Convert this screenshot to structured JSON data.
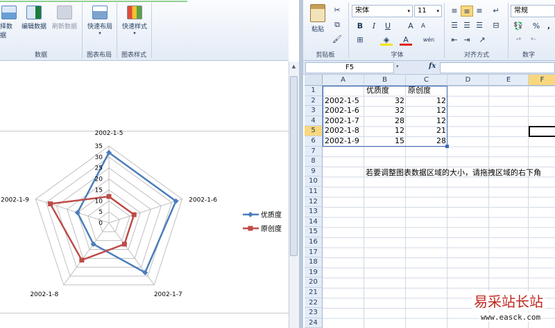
{
  "left_ribbon": {
    "group_data": {
      "label": "数据",
      "buttons": [
        {
          "label": "择数据"
        },
        {
          "label": "编辑数据"
        },
        {
          "label": "刷新数据"
        }
      ]
    },
    "group_layout": {
      "label": "图表布局",
      "button": "快速布局"
    },
    "group_style": {
      "label": "图表样式",
      "button": "快速样式"
    }
  },
  "right_ribbon": {
    "clipboard": {
      "label": "剪贴板",
      "paste": "粘贴"
    },
    "font": {
      "label": "字体",
      "name": "宋体",
      "size": "11",
      "bold": "B",
      "italic": "I",
      "underline": "U",
      "grow": "A",
      "shrink": "A",
      "wen": "wén"
    },
    "alignment": {
      "label": "对齐方式"
    },
    "number": {
      "label": "数字",
      "format": "常规",
      "percent": "%",
      "comma": ","
    }
  },
  "formula_bar": {
    "name_box": "F5",
    "fx": "fx",
    "formula": ""
  },
  "sheet": {
    "col_headers": [
      "A",
      "B",
      "C",
      "D",
      "E",
      "F"
    ],
    "rows": [
      "1",
      "2",
      "3",
      "4",
      "5",
      "6",
      "7",
      "8",
      "9",
      "10",
      "11",
      "12",
      "13",
      "14",
      "15",
      "16",
      "17",
      "18",
      "19",
      "20",
      "21",
      "22",
      "23",
      "24"
    ],
    "header_row": [
      "",
      "优质度",
      "原创度"
    ],
    "data_rows": [
      [
        "2002-1-5",
        "32",
        "12"
      ],
      [
        "2002-1-6",
        "32",
        "12"
      ],
      [
        "2002-1-7",
        "28",
        "12"
      ],
      [
        "2002-1-8",
        "12",
        "21"
      ],
      [
        "2002-1-9",
        "15",
        "28"
      ]
    ],
    "hint": "若要调整图表数据区域的大小，请拖拽区域的右下角"
  },
  "chart_data": {
    "type": "radar",
    "categories": [
      "2002-1-5",
      "2002-1-6",
      "2002-1-7",
      "2002-1-8",
      "2002-1-9"
    ],
    "series": [
      {
        "name": "优质度",
        "values": [
          32,
          32,
          28,
          12,
          15
        ],
        "color": "#4a7ebb"
      },
      {
        "name": "原创度",
        "values": [
          12,
          12,
          12,
          21,
          28
        ],
        "color": "#be4b48"
      }
    ],
    "ticks": [
      "0",
      "5",
      "10",
      "15",
      "20",
      "25",
      "30",
      "35"
    ],
    "rmax": 35,
    "legend": "right"
  },
  "watermark": {
    "text": "易采站长站",
    "url": "www.easck.com"
  }
}
